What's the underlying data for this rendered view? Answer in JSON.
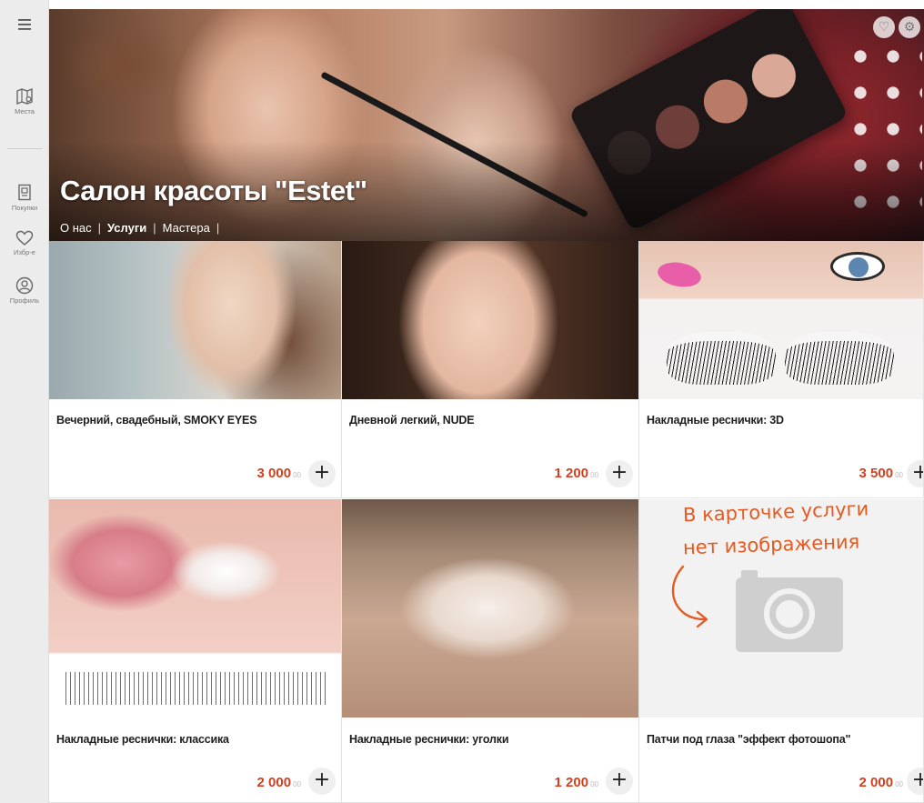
{
  "sidebar": {
    "menu_icon": "hamburger-icon",
    "items": [
      {
        "label": "Места",
        "icon": "map-icon"
      },
      {
        "label": "Покупки",
        "icon": "receipt-icon"
      },
      {
        "label": "Избр-е",
        "icon": "heart-icon"
      },
      {
        "label": "Профиль",
        "icon": "user-icon"
      }
    ]
  },
  "hero": {
    "title": "Салон красоты \"Estet\"",
    "nav": [
      {
        "label": "О нас",
        "active": false
      },
      {
        "label": "Услуги",
        "active": true
      },
      {
        "label": "Мастера",
        "active": false
      }
    ],
    "nav_separator": "|",
    "icons": [
      "heart-icon",
      "gear-icon"
    ]
  },
  "services": [
    {
      "title": "Вечерний, свадебный, SMOKY EYES",
      "price": "3 000",
      "cents": "00"
    },
    {
      "title": "Дневной легкий, NUDE",
      "price": "1 200",
      "cents": "00"
    },
    {
      "title": "Накладные реснички: 3D",
      "price": "3 500",
      "cents": "00"
    },
    {
      "title": "Накладные реснички: классика",
      "price": "2 000",
      "cents": "00"
    },
    {
      "title": "Накладные реснички: уголки",
      "price": "1 200",
      "cents": "00"
    },
    {
      "title": "Патчи под глаза \"эффект фотошопа\"",
      "price": "2 000",
      "cents": "00"
    }
  ],
  "add_label": "+",
  "annotation": {
    "line1": "В карточке услуги",
    "line2": "нет изображения"
  },
  "colors": {
    "accent": "#d2401f",
    "annotation": "#e65a1f"
  }
}
